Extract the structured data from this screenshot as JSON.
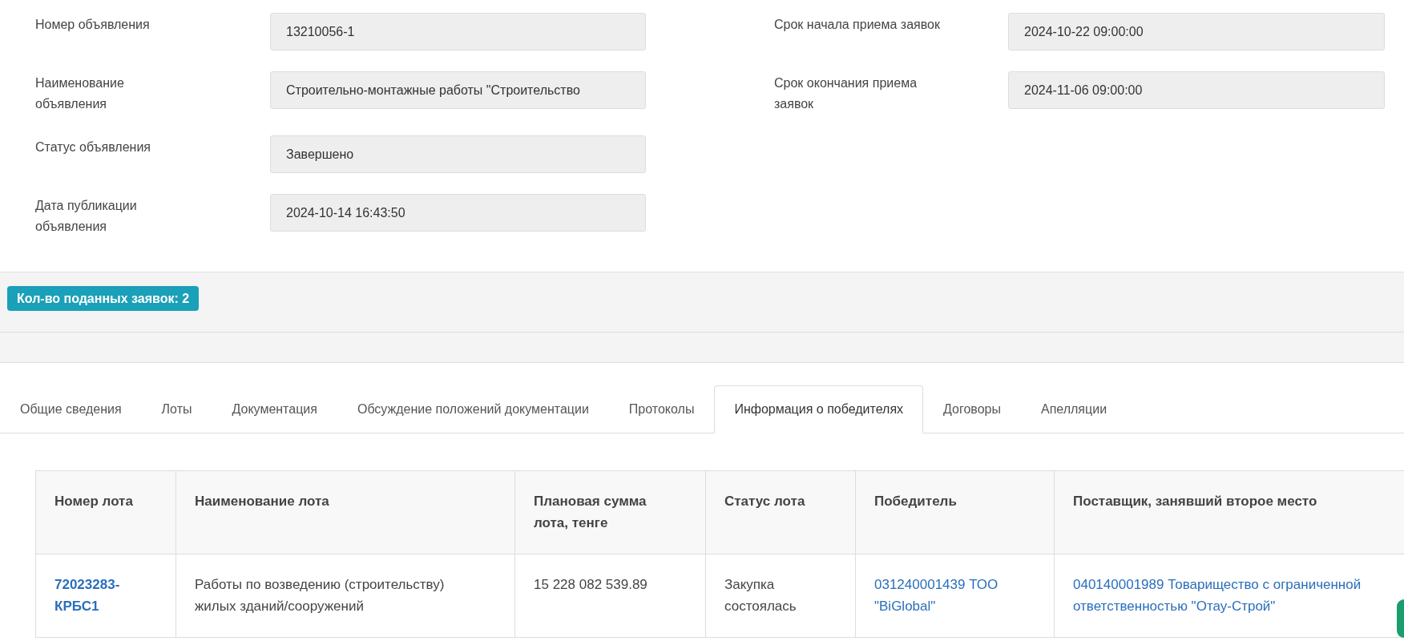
{
  "form_left": [
    {
      "label": "Номер объявления",
      "value": "13210056-1"
    },
    {
      "label": "Наименование объявления",
      "value": "Строительно-монтажные работы \"Строительство"
    },
    {
      "label": "Статус объявления",
      "value": "Завершено"
    },
    {
      "label": "Дата публикации объявления",
      "value": "2024-10-14 16:43:50"
    }
  ],
  "form_right": [
    {
      "label": "Срок начала приема заявок",
      "value": "2024-10-22 09:00:00"
    },
    {
      "label": "Срок окончания приема заявок",
      "value": "2024-11-06 09:00:00"
    }
  ],
  "badge": "Кол-во поданных заявок: 2",
  "tabs": [
    {
      "label": "Общие сведения",
      "selected": false
    },
    {
      "label": "Лоты",
      "selected": false
    },
    {
      "label": "Документация",
      "selected": false
    },
    {
      "label": "Обсуждение положений документации",
      "selected": false
    },
    {
      "label": "Протоколы",
      "selected": false
    },
    {
      "label": "Информация о победителях",
      "selected": true
    },
    {
      "label": "Договоры",
      "selected": false
    },
    {
      "label": "Апелляции",
      "selected": false
    }
  ],
  "table": {
    "columns": [
      "Номер лота",
      "Наименование лота",
      "Плановая сумма лота, тенге",
      "Статус лота",
      "Победитель",
      "Поставщик, занявший второе место"
    ],
    "rows": [
      [
        {
          "kind": "lot-link",
          "text": "72023283-КРБС1"
        },
        {
          "kind": "text",
          "text": "Работы по возведению (строительству) жилых зданий/сооружений"
        },
        {
          "kind": "text",
          "text": "15 228 082 539.89"
        },
        {
          "kind": "text",
          "text": "Закупка состоялась"
        },
        {
          "kind": "link",
          "text": "031240001439 ТОО \"BiGlobal\""
        },
        {
          "kind": "link",
          "text": "040140001989 Товарищество с ограниченной ответственностью \"Отау-Строй\""
        }
      ]
    ]
  }
}
